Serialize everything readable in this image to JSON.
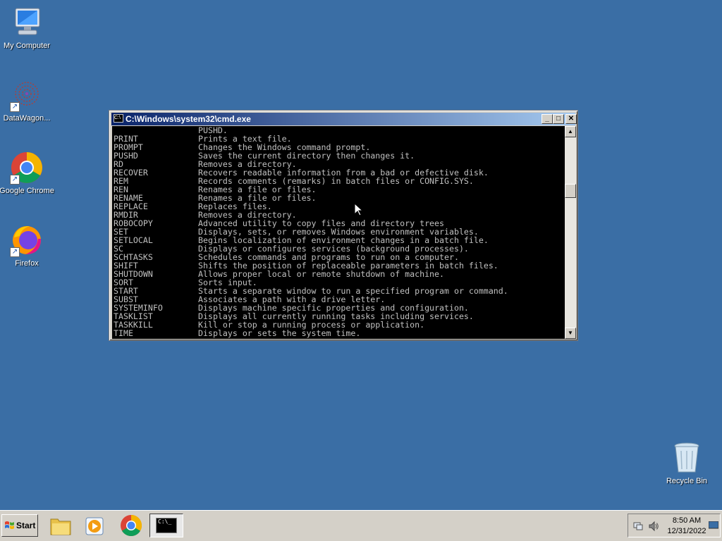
{
  "desktop": {
    "icons": [
      {
        "label": "My Computer",
        "icon": "my-computer-icon"
      },
      {
        "label": "DataWagon...",
        "icon": "datawagon-icon"
      },
      {
        "label": "Google Chrome",
        "icon": "chrome-icon"
      },
      {
        "label": "Firefox",
        "icon": "firefox-icon"
      },
      {
        "label": "Recycle Bin",
        "icon": "recycle-bin-icon"
      }
    ]
  },
  "cmd": {
    "title": "C:\\Windows\\system32\\cmd.exe",
    "icon_text": "C:\\",
    "lines": [
      {
        "name": "",
        "desc": "PUSHD."
      },
      {
        "name": "PRINT",
        "desc": "Prints a text file."
      },
      {
        "name": "PROMPT",
        "desc": "Changes the Windows command prompt."
      },
      {
        "name": "PUSHD",
        "desc": "Saves the current directory then changes it."
      },
      {
        "name": "RD",
        "desc": "Removes a directory."
      },
      {
        "name": "RECOVER",
        "desc": "Recovers readable information from a bad or defective disk."
      },
      {
        "name": "REM",
        "desc": "Records comments (remarks) in batch files or CONFIG.SYS."
      },
      {
        "name": "REN",
        "desc": "Renames a file or files."
      },
      {
        "name": "RENAME",
        "desc": "Renames a file or files."
      },
      {
        "name": "REPLACE",
        "desc": "Replaces files."
      },
      {
        "name": "RMDIR",
        "desc": "Removes a directory."
      },
      {
        "name": "ROBOCOPY",
        "desc": "Advanced utility to copy files and directory trees"
      },
      {
        "name": "SET",
        "desc": "Displays, sets, or removes Windows environment variables."
      },
      {
        "name": "SETLOCAL",
        "desc": "Begins localization of environment changes in a batch file."
      },
      {
        "name": "SC",
        "desc": "Displays or configures services (background processes)."
      },
      {
        "name": "SCHTASKS",
        "desc": "Schedules commands and programs to run on a computer."
      },
      {
        "name": "SHIFT",
        "desc": "Shifts the position of replaceable parameters in batch files."
      },
      {
        "name": "SHUTDOWN",
        "desc": "Allows proper local or remote shutdown of machine."
      },
      {
        "name": "SORT",
        "desc": "Sorts input."
      },
      {
        "name": "START",
        "desc": "Starts a separate window to run a specified program or command."
      },
      {
        "name": "SUBST",
        "desc": "Associates a path with a drive letter."
      },
      {
        "name": "SYSTEMINFO",
        "desc": "Displays machine specific properties and configuration."
      },
      {
        "name": "TASKLIST",
        "desc": "Displays all currently running tasks including services."
      },
      {
        "name": "TASKKILL",
        "desc": "Kill or stop a running process or application."
      },
      {
        "name": "TIME",
        "desc": "Displays or sets the system time."
      }
    ]
  },
  "taskbar": {
    "start_label": "Start",
    "buttons": [
      {
        "icon": "file-explorer-icon"
      },
      {
        "icon": "media-player-icon"
      },
      {
        "icon": "chrome-icon"
      },
      {
        "icon": "command-prompt-icon",
        "text": "C:\\_"
      }
    ],
    "clock": {
      "time": "8:50 AM",
      "date": "12/31/2022"
    }
  },
  "colors": {
    "desktop": "#3a6ea5",
    "console_bg": "#000000",
    "console_text": "#c0c0c0",
    "titlebar_start": "#0a246a",
    "titlebar_end": "#a6caf0"
  }
}
